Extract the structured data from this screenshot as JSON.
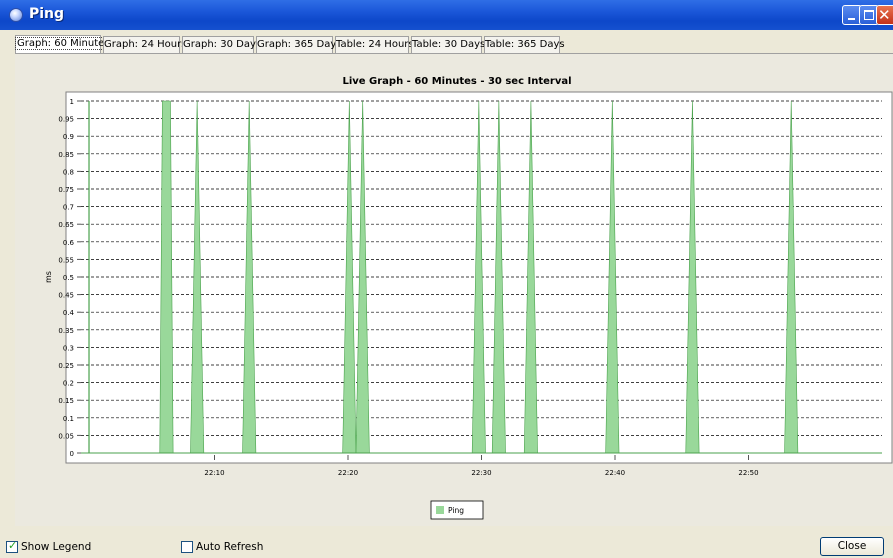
{
  "window": {
    "title": "Ping"
  },
  "tabs": [
    {
      "label": "Graph: 60 Minutes",
      "active": true
    },
    {
      "label": "Graph: 24 Hours",
      "active": false
    },
    {
      "label": "Graph: 30 Days",
      "active": false
    },
    {
      "label": "Graph: 365 Days",
      "active": false
    },
    {
      "label": "Table: 24 Hours",
      "active": false
    },
    {
      "label": "Table: 30 Days",
      "active": false
    },
    {
      "label": "Table: 365 Days",
      "active": false
    }
  ],
  "chart_data": {
    "type": "area",
    "title": "Live Graph - 60 Minutes - 30 sec Interval",
    "xlabel": "",
    "ylabel": "ms",
    "x_domain_minutes": [
      0,
      60
    ],
    "x_ticks": [
      "22:10",
      "22:20",
      "22:30",
      "22:40",
      "22:50"
    ],
    "x_tick_minutes": [
      10,
      20,
      30,
      40,
      50
    ],
    "ylim": [
      0,
      1
    ],
    "y_ticks": [
      "0",
      "0.05",
      "0.1",
      "0.15",
      "0.2",
      "0.25",
      "0.3",
      "0.35",
      "0.4",
      "0.45",
      "0.5",
      "0.55",
      "0.6",
      "0.65",
      "0.7",
      "0.75",
      "0.8",
      "0.85",
      "0.9",
      "0.95",
      "1"
    ],
    "grid": true,
    "legend_position": "bottom",
    "series": [
      {
        "name": "Ping",
        "color": "#99d89a",
        "stroke": "#4aa24c",
        "spikes": [
          {
            "center_minute": 0.6,
            "width": 0.0,
            "flat_top": 0.0
          },
          {
            "center_minute": 6.4,
            "width": 1.0,
            "flat_top": 0.6
          },
          {
            "center_minute": 8.7,
            "width": 1.0,
            "flat_top": 0.0
          },
          {
            "center_minute": 12.6,
            "width": 1.0,
            "flat_top": 0.0
          },
          {
            "center_minute": 20.1,
            "width": 1.0,
            "flat_top": 0.0
          },
          {
            "center_minute": 21.1,
            "width": 1.0,
            "flat_top": 0.0
          },
          {
            "center_minute": 29.8,
            "width": 1.0,
            "flat_top": 0.0
          },
          {
            "center_minute": 31.3,
            "width": 1.0,
            "flat_top": 0.0
          },
          {
            "center_minute": 33.7,
            "width": 1.0,
            "flat_top": 0.0
          },
          {
            "center_minute": 39.8,
            "width": 1.0,
            "flat_top": 0.0
          },
          {
            "center_minute": 45.8,
            "width": 1.0,
            "flat_top": 0.0
          },
          {
            "center_minute": 53.2,
            "width": 1.0,
            "flat_top": 0.0
          }
        ]
      }
    ]
  },
  "footer": {
    "show_legend_label": "Show Legend",
    "show_legend_checked": true,
    "auto_refresh_label": "Auto Refresh",
    "auto_refresh_checked": false,
    "close_label": "Close"
  },
  "colors": {
    "titlebar": "#1a56d8",
    "dialog_bg": "#ece9d8",
    "series_fill": "#99d89a",
    "series_stroke": "#4aa24c"
  }
}
